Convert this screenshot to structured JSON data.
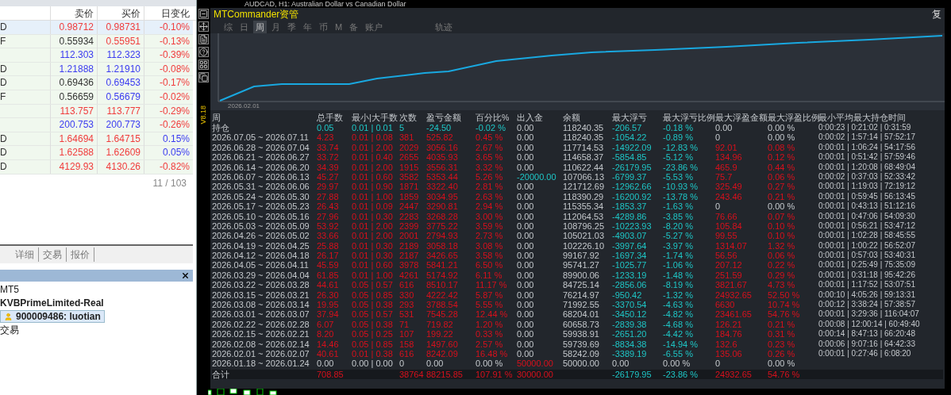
{
  "chart_window": {
    "title": "AUDCAD, H1:  Australian Dollar vs Canadian Dollar"
  },
  "market_watch": {
    "columns": [
      "卖价",
      "买价",
      "日变化"
    ],
    "rows": [
      {
        "symbol": "D",
        "selected": true,
        "prices": [
          {
            "text": "0.98712",
            "color": "#f03c3c"
          },
          {
            "text": "0.98731",
            "color": "#f03c3c"
          },
          {
            "text": "-0.10%",
            "color": "#f03c3c"
          }
        ]
      },
      {
        "symbol": "F",
        "selected": false,
        "prices": [
          {
            "text": "0.55934",
            "color": "#333333"
          },
          {
            "text": "0.55951",
            "color": "#f03c3c"
          },
          {
            "text": "-0.13%",
            "color": "#f03c3c"
          }
        ]
      },
      {
        "selected": false,
        "prices": [
          {
            "text": "112.303",
            "color": "#3b3bf0"
          },
          {
            "text": "112.323",
            "color": "#3b3bf0"
          },
          {
            "text": "-0.39%",
            "color": "#f03c3c"
          }
        ]
      },
      {
        "symbol": "D",
        "selected": false,
        "prices": [
          {
            "text": "1.21888",
            "color": "#3b3bf0"
          },
          {
            "text": "1.21910",
            "color": "#3b3bf0"
          },
          {
            "text": "-0.08%",
            "color": "#f03c3c"
          }
        ]
      },
      {
        "symbol": "D",
        "selected": false,
        "prices": [
          {
            "text": "0.69436",
            "color": "#333333"
          },
          {
            "text": "0.69453",
            "color": "#3b3bf0"
          },
          {
            "text": "-0.17%",
            "color": "#f03c3c"
          }
        ]
      },
      {
        "symbol": "F",
        "selected": false,
        "prices": [
          {
            "text": "0.56659",
            "color": "#333333"
          },
          {
            "text": "0.56679",
            "color": "#3b3bf0"
          },
          {
            "text": "-0.02%",
            "color": "#f03c3c"
          }
        ]
      },
      {
        "selected": false,
        "prices": [
          {
            "text": "113.757",
            "color": "#f03c3c"
          },
          {
            "text": "113.777",
            "color": "#f03c3c"
          },
          {
            "text": "-0.29%",
            "color": "#f03c3c"
          }
        ]
      },
      {
        "selected": false,
        "prices": [
          {
            "text": "200.753",
            "color": "#3b3bf0"
          },
          {
            "text": "200.773",
            "color": "#3b3bf0"
          },
          {
            "text": "-0.26%",
            "color": "#f03c3c"
          }
        ]
      },
      {
        "symbol": "D",
        "selected": false,
        "prices": [
          {
            "text": "1.64694",
            "color": "#f03c3c"
          },
          {
            "text": "1.64715",
            "color": "#f03c3c"
          },
          {
            "text": "0.15%",
            "color": "#3b3bf0"
          }
        ]
      },
      {
        "symbol": "D",
        "selected": false,
        "prices": [
          {
            "text": "1.62588",
            "color": "#f03c3c"
          },
          {
            "text": "1.62609",
            "color": "#f03c3c"
          },
          {
            "text": "0.05%",
            "color": "#3b3bf0"
          }
        ]
      },
      {
        "symbol": "D",
        "selected": false,
        "prices": [
          {
            "text": "4129.93",
            "color": "#f03c3c"
          },
          {
            "text": "4130.26",
            "color": "#f03c3c"
          },
          {
            "text": "-0.82%",
            "color": "#f03c3c"
          }
        ]
      }
    ],
    "count": "11 / 103"
  },
  "bottom_tabs": [
    {
      "label": "详细",
      "selected": false
    },
    {
      "label": "交易",
      "selected": false
    },
    {
      "label": "报价",
      "selected": false
    }
  ],
  "navigator": {
    "items": [
      {
        "label": "MT5",
        "bold": false,
        "selected": false,
        "kind": "text"
      },
      {
        "label": "KVBPrimeLimited-Real",
        "bold": true,
        "selected": false,
        "kind": "text"
      },
      {
        "label": "900009486: luotian",
        "bold": true,
        "selected": true,
        "kind": "account"
      },
      {
        "label": "交易",
        "bold": false,
        "selected": false,
        "kind": "text"
      }
    ]
  },
  "panel": {
    "title": "MTCommander资管",
    "corner": "复",
    "tabs": [
      {
        "label": "综",
        "selected": false
      },
      {
        "label": "日",
        "selected": false
      },
      {
        "label": "周",
        "selected": true
      },
      {
        "label": "月",
        "selected": false
      },
      {
        "label": "季",
        "selected": false
      },
      {
        "label": "年",
        "selected": false
      },
      {
        "label": "币",
        "selected": false
      },
      {
        "label": "M",
        "selected": false
      },
      {
        "label": "备",
        "selected": false
      },
      {
        "label": "账户",
        "selected": false
      }
    ],
    "track_button": "轨迹",
    "chart_date": "2026.02.01",
    "version": "V8.18",
    "table": {
      "columns": [
        "周",
        "总手数",
        "最小|大手数",
        "次数",
        "盈亏金额",
        "百分比%",
        "出入金",
        "余额",
        "最大浮亏",
        "最大浮亏比例",
        "最大浮盈金额",
        "最大浮盈比例",
        "最小平均最大持仓时间"
      ],
      "rows": [
        {
          "kind": "data",
          "cells": [
            {
              "text": "持仓",
              "kind": "flat"
            },
            {
              "text": "0.05",
              "kind": "down"
            },
            {
              "text": "0.01 | 0.01",
              "kind": "down"
            },
            {
              "text": "5",
              "kind": "down"
            },
            {
              "text": "-24.50",
              "kind": "down"
            },
            {
              "text": "-0.02 %",
              "kind": "down"
            },
            {
              "text": "0.00",
              "kind": "flat"
            },
            {
              "text": "118240.35",
              "kind": "flat"
            },
            {
              "text": "-206.57",
              "kind": "down"
            },
            {
              "text": "-0.18 %",
              "kind": "down"
            },
            {
              "text": "0.00",
              "kind": "flat"
            },
            {
              "text": "0.00 %",
              "kind": "flat"
            },
            {
              "text": "0:00:23 | 0:21:02 | 0:31:59",
              "kind": "flat"
            }
          ]
        },
        {
          "kind": "data",
          "cells": [
            {
              "text": "2026.07.05 ~ 2026.07.11",
              "kind": "flat"
            },
            {
              "text": "4.23",
              "kind": "up"
            },
            {
              "text": "0.01 | 0.08",
              "kind": "up"
            },
            {
              "text": "381",
              "kind": "up"
            },
            {
              "text": "525.82",
              "kind": "up"
            },
            {
              "text": "0.45 %",
              "kind": "up"
            },
            {
              "text": "0.00",
              "kind": "flat"
            },
            {
              "text": "118240.35",
              "kind": "flat"
            },
            {
              "text": "-1054.22",
              "kind": "down"
            },
            {
              "text": "-0.89 %",
              "kind": "down"
            },
            {
              "text": "0",
              "kind": "flat"
            },
            {
              "text": "0.00 %",
              "kind": "flat"
            },
            {
              "text": "0:00:02 | 1:57:14 | 57:52:17",
              "kind": "flat"
            }
          ]
        },
        {
          "kind": "data",
          "cells": [
            {
              "text": "2026.06.28 ~ 2026.07.04",
              "kind": "flat"
            },
            {
              "text": "33.74",
              "kind": "up"
            },
            {
              "text": "0.01 | 2.00",
              "kind": "up"
            },
            {
              "text": "2029",
              "kind": "up"
            },
            {
              "text": "3056.16",
              "kind": "up"
            },
            {
              "text": "2.67 %",
              "kind": "up"
            },
            {
              "text": "0.00",
              "kind": "flat"
            },
            {
              "text": "117714.53",
              "kind": "flat"
            },
            {
              "text": "-14922.09",
              "kind": "down"
            },
            {
              "text": "-12.83 %",
              "kind": "down"
            },
            {
              "text": "92.01",
              "kind": "up"
            },
            {
              "text": "0.08 %",
              "kind": "up"
            },
            {
              "text": "0:00:01 | 1:06:24 | 54:17:56",
              "kind": "flat"
            }
          ]
        },
        {
          "kind": "data",
          "cells": [
            {
              "text": "2026.06.21 ~ 2026.06.27",
              "kind": "flat"
            },
            {
              "text": "33.72",
              "kind": "up"
            },
            {
              "text": "0.01 | 0.40",
              "kind": "up"
            },
            {
              "text": "2655",
              "kind": "up"
            },
            {
              "text": "4035.93",
              "kind": "up"
            },
            {
              "text": "3.65 %",
              "kind": "up"
            },
            {
              "text": "0.00",
              "kind": "flat"
            },
            {
              "text": "114658.37",
              "kind": "flat"
            },
            {
              "text": "-5854.85",
              "kind": "down"
            },
            {
              "text": "-5.12 %",
              "kind": "down"
            },
            {
              "text": "134.96",
              "kind": "up"
            },
            {
              "text": "0.12 %",
              "kind": "up"
            },
            {
              "text": "0:00:01 | 0:51:42 | 57:59:46",
              "kind": "flat"
            }
          ]
        },
        {
          "kind": "data",
          "cells": [
            {
              "text": "2026.06.14 ~ 2026.06.20",
              "kind": "flat"
            },
            {
              "text": "34.39",
              "kind": "up"
            },
            {
              "text": "0.01 | 2.00",
              "kind": "up"
            },
            {
              "text": "1915",
              "kind": "up"
            },
            {
              "text": "3556.31",
              "kind": "up"
            },
            {
              "text": "3.32 %",
              "kind": "up"
            },
            {
              "text": "0.00",
              "kind": "flat"
            },
            {
              "text": "110622.44",
              "kind": "flat"
            },
            {
              "text": "-26179.95",
              "kind": "down"
            },
            {
              "text": "-23.86 %",
              "kind": "down"
            },
            {
              "text": "465.9",
              "kind": "up"
            },
            {
              "text": "0.44 %",
              "kind": "up"
            },
            {
              "text": "0:00:01 | 1:20:08 | 68:49:04",
              "kind": "flat"
            }
          ]
        },
        {
          "kind": "data",
          "cells": [
            {
              "text": "2026.06.07 ~ 2026.06.13",
              "kind": "flat"
            },
            {
              "text": "45.27",
              "kind": "up"
            },
            {
              "text": "0.01 | 0.60",
              "kind": "up"
            },
            {
              "text": "3582",
              "kind": "up"
            },
            {
              "text": "5353.44",
              "kind": "up"
            },
            {
              "text": "5.26 %",
              "kind": "up"
            },
            {
              "text": "-20000.00",
              "kind": "down"
            },
            {
              "text": "107066.13",
              "kind": "flat"
            },
            {
              "text": "-6799.37",
              "kind": "down"
            },
            {
              "text": "-5.53 %",
              "kind": "down"
            },
            {
              "text": "75.7",
              "kind": "up"
            },
            {
              "text": "0.06 %",
              "kind": "up"
            },
            {
              "text": "0:00:02 | 0:37:03 | 52:33:42",
              "kind": "flat"
            }
          ]
        },
        {
          "kind": "data",
          "cells": [
            {
              "text": "2026.05.31 ~ 2026.06.06",
              "kind": "flat"
            },
            {
              "text": "29.97",
              "kind": "up"
            },
            {
              "text": "0.01 | 0.90",
              "kind": "up"
            },
            {
              "text": "1871",
              "kind": "up"
            },
            {
              "text": "3322.40",
              "kind": "up"
            },
            {
              "text": "2.81 %",
              "kind": "up"
            },
            {
              "text": "0.00",
              "kind": "flat"
            },
            {
              "text": "121712.69",
              "kind": "flat"
            },
            {
              "text": "-12962.66",
              "kind": "down"
            },
            {
              "text": "-10.93 %",
              "kind": "down"
            },
            {
              "text": "325.49",
              "kind": "up"
            },
            {
              "text": "0.27 %",
              "kind": "up"
            },
            {
              "text": "0:00:01 | 1:19:03 | 72:19:12",
              "kind": "flat"
            }
          ]
        },
        {
          "kind": "data",
          "cells": [
            {
              "text": "2026.05.24 ~ 2026.05.30",
              "kind": "flat"
            },
            {
              "text": "27.88",
              "kind": "up"
            },
            {
              "text": "0.01 | 1.00",
              "kind": "up"
            },
            {
              "text": "1859",
              "kind": "up"
            },
            {
              "text": "3034.95",
              "kind": "up"
            },
            {
              "text": "2.63 %",
              "kind": "up"
            },
            {
              "text": "0.00",
              "kind": "flat"
            },
            {
              "text": "118390.29",
              "kind": "flat"
            },
            {
              "text": "-16200.92",
              "kind": "down"
            },
            {
              "text": "-13.78 %",
              "kind": "down"
            },
            {
              "text": "243.46",
              "kind": "up"
            },
            {
              "text": "0.21 %",
              "kind": "up"
            },
            {
              "text": "0:00:01 | 0:59:45 | 56:13:45",
              "kind": "flat"
            }
          ]
        },
        {
          "kind": "data",
          "cells": [
            {
              "text": "2026.05.17 ~ 2026.05.23",
              "kind": "flat"
            },
            {
              "text": "26.43",
              "kind": "up"
            },
            {
              "text": "0.01 | 0.09",
              "kind": "up"
            },
            {
              "text": "2447",
              "kind": "up"
            },
            {
              "text": "3290.81",
              "kind": "up"
            },
            {
              "text": "2.94 %",
              "kind": "up"
            },
            {
              "text": "0.00",
              "kind": "flat"
            },
            {
              "text": "115355.34",
              "kind": "flat"
            },
            {
              "text": "-1853.37",
              "kind": "down"
            },
            {
              "text": "-1.63 %",
              "kind": "down"
            },
            {
              "text": "0",
              "kind": "flat"
            },
            {
              "text": "0.00 %",
              "kind": "flat"
            },
            {
              "text": "0:00:01 | 0:43:13 | 51:12:16",
              "kind": "flat"
            }
          ]
        },
        {
          "kind": "data",
          "cells": [
            {
              "text": "2026.05.10 ~ 2026.05.16",
              "kind": "flat"
            },
            {
              "text": "27.96",
              "kind": "up"
            },
            {
              "text": "0.01 | 0.30",
              "kind": "up"
            },
            {
              "text": "2283",
              "kind": "up"
            },
            {
              "text": "3268.28",
              "kind": "up"
            },
            {
              "text": "3.00 %",
              "kind": "up"
            },
            {
              "text": "0.00",
              "kind": "flat"
            },
            {
              "text": "112064.53",
              "kind": "flat"
            },
            {
              "text": "-4289.86",
              "kind": "down"
            },
            {
              "text": "-3.85 %",
              "kind": "down"
            },
            {
              "text": "76.66",
              "kind": "up"
            },
            {
              "text": "0.07 %",
              "kind": "up"
            },
            {
              "text": "0:00:01 | 0:47:06 | 54:09:30",
              "kind": "flat"
            }
          ]
        },
        {
          "kind": "data",
          "cells": [
            {
              "text": "2026.05.03 ~ 2026.05.09",
              "kind": "flat"
            },
            {
              "text": "53.92",
              "kind": "up"
            },
            {
              "text": "0.01 | 2.00",
              "kind": "up"
            },
            {
              "text": "2399",
              "kind": "up"
            },
            {
              "text": "3775.22",
              "kind": "up"
            },
            {
              "text": "3.59 %",
              "kind": "up"
            },
            {
              "text": "0.00",
              "kind": "flat"
            },
            {
              "text": "108796.25",
              "kind": "flat"
            },
            {
              "text": "-10223.93",
              "kind": "down"
            },
            {
              "text": "-8.20 %",
              "kind": "down"
            },
            {
              "text": "105.84",
              "kind": "up"
            },
            {
              "text": "0.10 %",
              "kind": "up"
            },
            {
              "text": "0:00:01 | 0:56:21 | 53:47:12",
              "kind": "flat"
            }
          ]
        },
        {
          "kind": "data",
          "cells": [
            {
              "text": "2026.04.26 ~ 2026.05.02",
              "kind": "flat"
            },
            {
              "text": "33.66",
              "kind": "up"
            },
            {
              "text": "0.01 | 2.00",
              "kind": "up"
            },
            {
              "text": "2001",
              "kind": "up"
            },
            {
              "text": "2794.93",
              "kind": "up"
            },
            {
              "text": "2.73 %",
              "kind": "up"
            },
            {
              "text": "0.00",
              "kind": "flat"
            },
            {
              "text": "105021.03",
              "kind": "flat"
            },
            {
              "text": "-4903.07",
              "kind": "down"
            },
            {
              "text": "-5.27 %",
              "kind": "down"
            },
            {
              "text": "99.55",
              "kind": "up"
            },
            {
              "text": "0.10 %",
              "kind": "up"
            },
            {
              "text": "0:00:01 | 1:02:28 | 58:45:55",
              "kind": "flat"
            }
          ]
        },
        {
          "kind": "data",
          "cells": [
            {
              "text": "2026.04.19 ~ 2026.04.25",
              "kind": "flat"
            },
            {
              "text": "25.88",
              "kind": "up"
            },
            {
              "text": "0.01 | 0.30",
              "kind": "up"
            },
            {
              "text": "2189",
              "kind": "up"
            },
            {
              "text": "3058.18",
              "kind": "up"
            },
            {
              "text": "3.08 %",
              "kind": "up"
            },
            {
              "text": "0.00",
              "kind": "flat"
            },
            {
              "text": "102226.10",
              "kind": "flat"
            },
            {
              "text": "-3997.64",
              "kind": "down"
            },
            {
              "text": "-3.97 %",
              "kind": "down"
            },
            {
              "text": "1314.07",
              "kind": "up"
            },
            {
              "text": "1.32 %",
              "kind": "up"
            },
            {
              "text": "0:00:01 | 1:00:22 | 56:52:07",
              "kind": "flat"
            }
          ]
        },
        {
          "kind": "data",
          "cells": [
            {
              "text": "2026.04.12 ~ 2026.04.18",
              "kind": "flat"
            },
            {
              "text": "26.17",
              "kind": "up"
            },
            {
              "text": "0.01 | 0.30",
              "kind": "up"
            },
            {
              "text": "2187",
              "kind": "up"
            },
            {
              "text": "3426.65",
              "kind": "up"
            },
            {
              "text": "3.58 %",
              "kind": "up"
            },
            {
              "text": "0.00",
              "kind": "flat"
            },
            {
              "text": "99167.92",
              "kind": "flat"
            },
            {
              "text": "-1697.34",
              "kind": "down"
            },
            {
              "text": "-1.74 %",
              "kind": "down"
            },
            {
              "text": "56.56",
              "kind": "up"
            },
            {
              "text": "0.06 %",
              "kind": "up"
            },
            {
              "text": "0:00:01 | 0:57:03 | 53:40:31",
              "kind": "flat"
            }
          ]
        },
        {
          "kind": "data",
          "cells": [
            {
              "text": "2026.04.05 ~ 2026.04.11",
              "kind": "flat"
            },
            {
              "text": "45.59",
              "kind": "up"
            },
            {
              "text": "0.01 | 0.60",
              "kind": "up"
            },
            {
              "text": "3978",
              "kind": "up"
            },
            {
              "text": "5841.21",
              "kind": "up"
            },
            {
              "text": "6.50 %",
              "kind": "up"
            },
            {
              "text": "0.00",
              "kind": "flat"
            },
            {
              "text": "95741.27",
              "kind": "flat"
            },
            {
              "text": "-1025.77",
              "kind": "down"
            },
            {
              "text": "-1.06 %",
              "kind": "down"
            },
            {
              "text": "207.12",
              "kind": "up"
            },
            {
              "text": "0.22 %",
              "kind": "up"
            },
            {
              "text": "0:00:01 | 0:25:49 | 75:35:09",
              "kind": "flat"
            }
          ]
        },
        {
          "kind": "data",
          "cells": [
            {
              "text": "2026.03.29 ~ 2026.04.04",
              "kind": "flat"
            },
            {
              "text": "61.85",
              "kind": "up"
            },
            {
              "text": "0.01 | 1.00",
              "kind": "up"
            },
            {
              "text": "4261",
              "kind": "up"
            },
            {
              "text": "5174.92",
              "kind": "up"
            },
            {
              "text": "6.11 %",
              "kind": "up"
            },
            {
              "text": "0.00",
              "kind": "flat"
            },
            {
              "text": "89900.06",
              "kind": "flat"
            },
            {
              "text": "-1233.19",
              "kind": "down"
            },
            {
              "text": "-1.48 %",
              "kind": "down"
            },
            {
              "text": "251.59",
              "kind": "up"
            },
            {
              "text": "0.29 %",
              "kind": "up"
            },
            {
              "text": "0:00:01 | 0:31:18 | 95:42:26",
              "kind": "flat"
            }
          ]
        },
        {
          "kind": "data",
          "cells": [
            {
              "text": "2026.03.22 ~ 2026.03.28",
              "kind": "flat"
            },
            {
              "text": "44.61",
              "kind": "up"
            },
            {
              "text": "0.05 | 0.57",
              "kind": "up"
            },
            {
              "text": "616",
              "kind": "up"
            },
            {
              "text": "8510.17",
              "kind": "up"
            },
            {
              "text": "11.17 %",
              "kind": "up"
            },
            {
              "text": "0.00",
              "kind": "flat"
            },
            {
              "text": "84725.14",
              "kind": "flat"
            },
            {
              "text": "-2856.06",
              "kind": "down"
            },
            {
              "text": "-8.19 %",
              "kind": "down"
            },
            {
              "text": "3821.67",
              "kind": "up"
            },
            {
              "text": "4.73 %",
              "kind": "up"
            },
            {
              "text": "0:00:01 | 1:17:52 | 53:07:51",
              "kind": "flat"
            }
          ]
        },
        {
          "kind": "data",
          "cells": [
            {
              "text": "2026.03.15 ~ 2026.03.21",
              "kind": "flat"
            },
            {
              "text": "26.30",
              "kind": "up"
            },
            {
              "text": "0.05 | 0.85",
              "kind": "up"
            },
            {
              "text": "330",
              "kind": "up"
            },
            {
              "text": "4222.42",
              "kind": "up"
            },
            {
              "text": "5.87 %",
              "kind": "up"
            },
            {
              "text": "0.00",
              "kind": "flat"
            },
            {
              "text": "76214.97",
              "kind": "flat"
            },
            {
              "text": "-950.42",
              "kind": "down"
            },
            {
              "text": "-1.32 %",
              "kind": "down"
            },
            {
              "text": "24932.65",
              "kind": "up"
            },
            {
              "text": "52.50 %",
              "kind": "up"
            },
            {
              "text": "0:00:10 | 4:05:26 | 59:13:31",
              "kind": "flat"
            }
          ]
        },
        {
          "kind": "data",
          "cells": [
            {
              "text": "2026.03.08 ~ 2026.03.14",
              "kind": "flat"
            },
            {
              "text": "19.95",
              "kind": "up"
            },
            {
              "text": "0.05 | 0.38",
              "kind": "up"
            },
            {
              "text": "293",
              "kind": "up"
            },
            {
              "text": "3788.54",
              "kind": "up"
            },
            {
              "text": "5.55 %",
              "kind": "up"
            },
            {
              "text": "0.00",
              "kind": "flat"
            },
            {
              "text": "71992.55",
              "kind": "flat"
            },
            {
              "text": "-3370.54",
              "kind": "down"
            },
            {
              "text": "-4.63 %",
              "kind": "down"
            },
            {
              "text": "6630",
              "kind": "up"
            },
            {
              "text": "10.74 %",
              "kind": "up"
            },
            {
              "text": "0:00:12 | 3:38:24 | 57:38:57",
              "kind": "flat"
            }
          ]
        },
        {
          "kind": "data",
          "cells": [
            {
              "text": "2026.03.01 ~ 2026.03.07",
              "kind": "flat"
            },
            {
              "text": "37.94",
              "kind": "up"
            },
            {
              "text": "0.05 | 0.57",
              "kind": "up"
            },
            {
              "text": "531",
              "kind": "up"
            },
            {
              "text": "7545.28",
              "kind": "up"
            },
            {
              "text": "12.44 %",
              "kind": "up"
            },
            {
              "text": "0.00",
              "kind": "flat"
            },
            {
              "text": "68204.01",
              "kind": "flat"
            },
            {
              "text": "-3450.12",
              "kind": "down"
            },
            {
              "text": "-4.82 %",
              "kind": "down"
            },
            {
              "text": "23461.65",
              "kind": "up"
            },
            {
              "text": "54.76 %",
              "kind": "up"
            },
            {
              "text": "0:00:01 | 3:29:36 | 116:04:07",
              "kind": "flat"
            }
          ]
        },
        {
          "kind": "data",
          "cells": [
            {
              "text": "2026.02.22 ~ 2026.02.28",
              "kind": "flat"
            },
            {
              "text": "6.07",
              "kind": "up"
            },
            {
              "text": "0.05 | 0.38",
              "kind": "up"
            },
            {
              "text": "71",
              "kind": "up"
            },
            {
              "text": "719.82",
              "kind": "up"
            },
            {
              "text": "1.20 %",
              "kind": "up"
            },
            {
              "text": "0.00",
              "kind": "flat"
            },
            {
              "text": "60658.73",
              "kind": "flat"
            },
            {
              "text": "-2839.38",
              "kind": "down"
            },
            {
              "text": "-4.68 %",
              "kind": "down"
            },
            {
              "text": "126.21",
              "kind": "up"
            },
            {
              "text": "0.21 %",
              "kind": "up"
            },
            {
              "text": "0:00:08 | 12:00:14 | 60:49:40",
              "kind": "flat"
            }
          ]
        },
        {
          "kind": "data",
          "cells": [
            {
              "text": "2026.02.15 ~ 2026.02.21",
              "kind": "flat"
            },
            {
              "text": "8.20",
              "kind": "up"
            },
            {
              "text": "0.05 | 0.25",
              "kind": "up"
            },
            {
              "text": "107",
              "kind": "up"
            },
            {
              "text": "199.22",
              "kind": "up"
            },
            {
              "text": "0.33 %",
              "kind": "up"
            },
            {
              "text": "0.00",
              "kind": "flat"
            },
            {
              "text": "59938.91",
              "kind": "flat"
            },
            {
              "text": "-2651.20",
              "kind": "down"
            },
            {
              "text": "-4.42 %",
              "kind": "down"
            },
            {
              "text": "184.76",
              "kind": "up"
            },
            {
              "text": "0.31 %",
              "kind": "up"
            },
            {
              "text": "0:00:14 | 8:47:13 | 66:20:48",
              "kind": "flat"
            }
          ]
        },
        {
          "kind": "data",
          "cells": [
            {
              "text": "2026.02.08 ~ 2026.02.14",
              "kind": "flat"
            },
            {
              "text": "14.46",
              "kind": "up"
            },
            {
              "text": "0.05 | 0.85",
              "kind": "up"
            },
            {
              "text": "158",
              "kind": "up"
            },
            {
              "text": "1497.60",
              "kind": "up"
            },
            {
              "text": "2.57 %",
              "kind": "up"
            },
            {
              "text": "0.00",
              "kind": "flat"
            },
            {
              "text": "59739.69",
              "kind": "flat"
            },
            {
              "text": "-8834.38",
              "kind": "down"
            },
            {
              "text": "-14.94 %",
              "kind": "down"
            },
            {
              "text": "132.6",
              "kind": "up"
            },
            {
              "text": "0.23 %",
              "kind": "up"
            },
            {
              "text": "0:00:06 | 9:07:16 | 64:42:33",
              "kind": "flat"
            }
          ]
        },
        {
          "kind": "data",
          "cells": [
            {
              "text": "2026.02.01 ~ 2026.02.07",
              "kind": "flat"
            },
            {
              "text": "40.61",
              "kind": "up"
            },
            {
              "text": "0.01 | 0.38",
              "kind": "up"
            },
            {
              "text": "616",
              "kind": "up"
            },
            {
              "text": "8242.09",
              "kind": "up"
            },
            {
              "text": "16.48 %",
              "kind": "up"
            },
            {
              "text": "0.00",
              "kind": "flat"
            },
            {
              "text": "58242.09",
              "kind": "flat"
            },
            {
              "text": "-3389.19",
              "kind": "down"
            },
            {
              "text": "-6.55 %",
              "kind": "down"
            },
            {
              "text": "135.06",
              "kind": "up"
            },
            {
              "text": "0.26 %",
              "kind": "up"
            },
            {
              "text": "0:00:01 | 0:27:46 | 6:08:20",
              "kind": "flat"
            }
          ]
        },
        {
          "kind": "data",
          "cells": [
            {
              "text": "2026.01.18 ~ 2026.01.24",
              "kind": "flat"
            },
            {
              "text": "0.00",
              "kind": "flat"
            },
            {
              "text": "0.00 | 0.00",
              "kind": "flat"
            },
            {
              "text": "0",
              "kind": "flat"
            },
            {
              "text": "0.00",
              "kind": "flat"
            },
            {
              "text": "0.00 %",
              "kind": "flat"
            },
            {
              "text": "50000.00",
              "kind": "up"
            },
            {
              "text": "50000.00",
              "kind": "flat"
            },
            {
              "text": "0.00",
              "kind": "flat"
            },
            {
              "text": "0.00 %",
              "kind": "flat"
            },
            {
              "text": "0",
              "kind": "flat"
            },
            {
              "text": "0.00 %",
              "kind": "flat"
            }
          ]
        },
        {
          "kind": "total",
          "cells": [
            {
              "text": "合计",
              "kind": "flat"
            },
            {
              "text": "708.85",
              "kind": "up"
            },
            null,
            {
              "text": "38764",
              "kind": "up"
            },
            {
              "text": "88215.85",
              "kind": "up"
            },
            {
              "text": "107.91 %",
              "kind": "up"
            },
            {
              "text": "30000.00",
              "kind": "up"
            },
            null,
            {
              "text": "-26179.95",
              "kind": "down"
            },
            {
              "text": "-23.86 %",
              "kind": "down"
            },
            {
              "text": "24932.65",
              "kind": "up"
            },
            {
              "text": "54.76 %",
              "kind": "up"
            }
          ]
        }
      ]
    }
  }
}
